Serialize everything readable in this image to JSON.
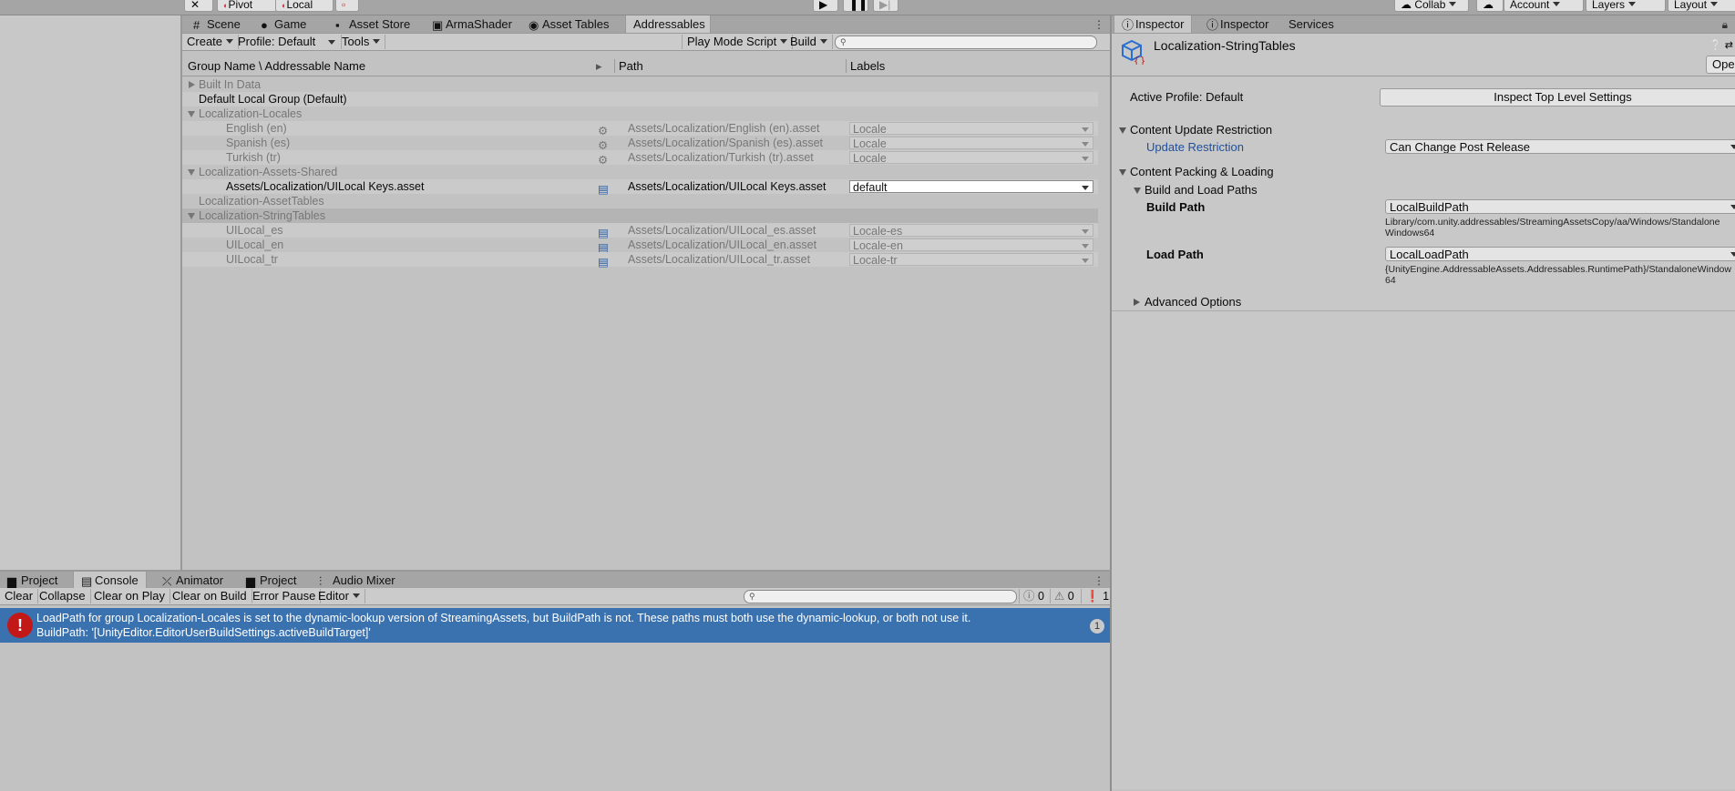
{
  "toolbar": {
    "pivot": "Pivot",
    "local": "Local",
    "collab": "Collab",
    "account": "Account",
    "layers": "Layers",
    "layout": "Layout"
  },
  "center_tabs": [
    "Scene",
    "Game",
    "Asset Store",
    "ArmaShader",
    "Asset Tables",
    "Addressables"
  ],
  "addressables_toolbar": {
    "create": "Create",
    "profile": "Profile: Default",
    "tools": "Tools",
    "play_mode_script": "Play Mode Script",
    "build": "Build"
  },
  "columns": {
    "name": "Group Name \\ Addressable Name",
    "path": "Path",
    "labels": "Labels"
  },
  "groups": [
    {
      "name": "Built In Data"
    },
    {
      "name": "Default Local Group (Default)"
    },
    {
      "name": "Localization-Locales"
    },
    {
      "name": "English (en)",
      "path": "Assets/Localization/English (en).asset",
      "label": "Locale"
    },
    {
      "name": "Spanish (es)",
      "path": "Assets/Localization/Spanish (es).asset",
      "label": "Locale"
    },
    {
      "name": "Turkish (tr)",
      "path": "Assets/Localization/Turkish (tr).asset",
      "label": "Locale"
    },
    {
      "name": "Localization-Assets-Shared"
    },
    {
      "name": "Assets/Localization/UILocal Keys.asset",
      "path": "Assets/Localization/UILocal Keys.asset",
      "label": "default"
    },
    {
      "name": "Localization-AssetTables"
    },
    {
      "name": "Localization-StringTables"
    },
    {
      "name": "UILocal_es",
      "path": "Assets/Localization/UILocal_es.asset",
      "label": "Locale-es"
    },
    {
      "name": "UILocal_en",
      "path": "Assets/Localization/UILocal_en.asset",
      "label": "Locale-en"
    },
    {
      "name": "UILocal_tr",
      "path": "Assets/Localization/UILocal_tr.asset",
      "label": "Locale-tr"
    }
  ],
  "inspector": {
    "tabs": [
      "Inspector",
      "Inspector",
      "Services"
    ],
    "title": "Localization-StringTables",
    "open": "Open",
    "active_profile": "Active Profile: Default",
    "inspect_top_level": "Inspect Top Level Settings",
    "content_update_restriction": "Content Update Restriction",
    "update_restriction_label": "Update Restriction",
    "update_restriction_value": "Can Change Post Release",
    "content_packing": "Content Packing & Loading",
    "build_load_paths": "Build and Load Paths",
    "build_path_label": "Build Path",
    "build_path_value": "LocalBuildPath",
    "build_path_resolved_1": "Library/com.unity.addressables/StreamingAssetsCopy/aa/Windows/Standalone",
    "build_path_resolved_2": "Windows64",
    "load_path_label": "Load Path",
    "load_path_value": "LocalLoadPath",
    "load_path_resolved_1": "{UnityEngine.AddressableAssets.Addressables.RuntimePath}/StandaloneWindow",
    "load_path_resolved_2": "64",
    "advanced_options": "Advanced Options"
  },
  "bottom_tabs": [
    "Project",
    "Console",
    "Animator",
    "Project",
    "Audio Mixer"
  ],
  "console": {
    "clear": "Clear",
    "collapse": "Collapse",
    "clear_on_play": "Clear on Play",
    "clear_on_build": "Clear on Build",
    "error_pause": "Error Pause",
    "editor": "Editor",
    "log_count": "0",
    "warn_count": "0",
    "error_count": "1",
    "message_line1": "LoadPath for group Localization-Locales is set to the dynamic-lookup version of StreamingAssets, but BuildPath is not. These paths must both use the dynamic-lookup, or both not use it.",
    "message_line2": "BuildPath: '[UnityEditor.EditorUserBuildSettings.activeBuildTarget]'",
    "message_count": "1"
  },
  "colors": {
    "selection": "#3a72b0",
    "error": "#c21818",
    "link": "#1f4f9c"
  }
}
